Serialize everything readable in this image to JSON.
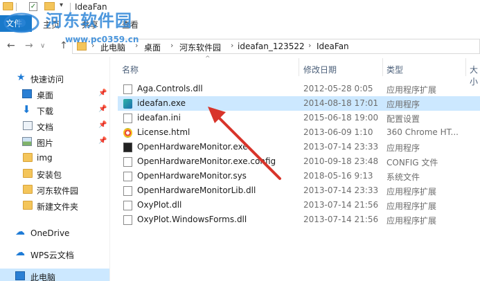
{
  "window": {
    "title": "IdeaFan"
  },
  "ribbon": {
    "tabs": [
      "文件",
      "主页",
      "共享",
      "查看"
    ]
  },
  "watermark": {
    "title": "河东软件园",
    "url": "www.pc0359.cn"
  },
  "address": {
    "crumbs": [
      "此电脑",
      "桌面",
      "河东软件园",
      "ideafan_123522",
      "IdeaFan"
    ]
  },
  "navpane": {
    "items": [
      {
        "label": "快速访问",
        "icon": "star-icon"
      },
      {
        "label": "桌面",
        "icon": "desktop-icon",
        "pinned": true
      },
      {
        "label": "下载",
        "icon": "download-icon",
        "pinned": true
      },
      {
        "label": "文档",
        "icon": "document-icon",
        "pinned": true
      },
      {
        "label": "图片",
        "icon": "picture-icon",
        "pinned": true
      },
      {
        "label": "img",
        "icon": "folder-icon"
      },
      {
        "label": "安装包",
        "icon": "folder-icon"
      },
      {
        "label": "河东软件园",
        "icon": "folder-icon"
      },
      {
        "label": "新建文件夹",
        "icon": "folder-icon"
      },
      {
        "label": "OneDrive",
        "icon": "cloud-icon"
      },
      {
        "label": "WPS云文档",
        "icon": "cloud-icon"
      },
      {
        "label": "此电脑",
        "icon": "computer-icon"
      }
    ]
  },
  "columns": {
    "name": "名称",
    "date": "修改日期",
    "type": "类型",
    "size": "大小"
  },
  "files": [
    {
      "name": "Aga.Controls.dll",
      "date": "2012-05-28 0:05",
      "type": "应用程序扩展",
      "icon": "dll-icon"
    },
    {
      "name": "ideafan.exe",
      "date": "2014-08-18 17:01",
      "type": "应用程序",
      "icon": "exe-icon"
    },
    {
      "name": "ideafan.ini",
      "date": "2015-06-18 19:00",
      "type": "配置设置",
      "icon": "ini-icon"
    },
    {
      "name": "License.html",
      "date": "2013-06-09 1:10",
      "type": "360 Chrome HT...",
      "icon": "html-icon"
    },
    {
      "name": "OpenHardwareMonitor.exe",
      "date": "2013-07-14 23:33",
      "type": "应用程序",
      "icon": "monitor-icon"
    },
    {
      "name": "OpenHardwareMonitor.exe.config",
      "date": "2010-09-18 23:48",
      "type": "CONFIG 文件",
      "icon": "file-icon"
    },
    {
      "name": "OpenHardwareMonitor.sys",
      "date": "2018-05-16 9:13",
      "type": "系统文件",
      "icon": "sys-icon"
    },
    {
      "name": "OpenHardwareMonitorLib.dll",
      "date": "2013-07-14 23:33",
      "type": "应用程序扩展",
      "icon": "dll-icon"
    },
    {
      "name": "OxyPlot.dll",
      "date": "2013-07-14 21:56",
      "type": "应用程序扩展",
      "icon": "dll-icon"
    },
    {
      "name": "OxyPlot.WindowsForms.dll",
      "date": "2013-07-14 21:56",
      "type": "应用程序扩展",
      "icon": "dll-icon"
    }
  ],
  "colors": {
    "selection": "#cce8ff",
    "file_tab": "#1979ca",
    "annotation_arrow": "#d8342a"
  }
}
